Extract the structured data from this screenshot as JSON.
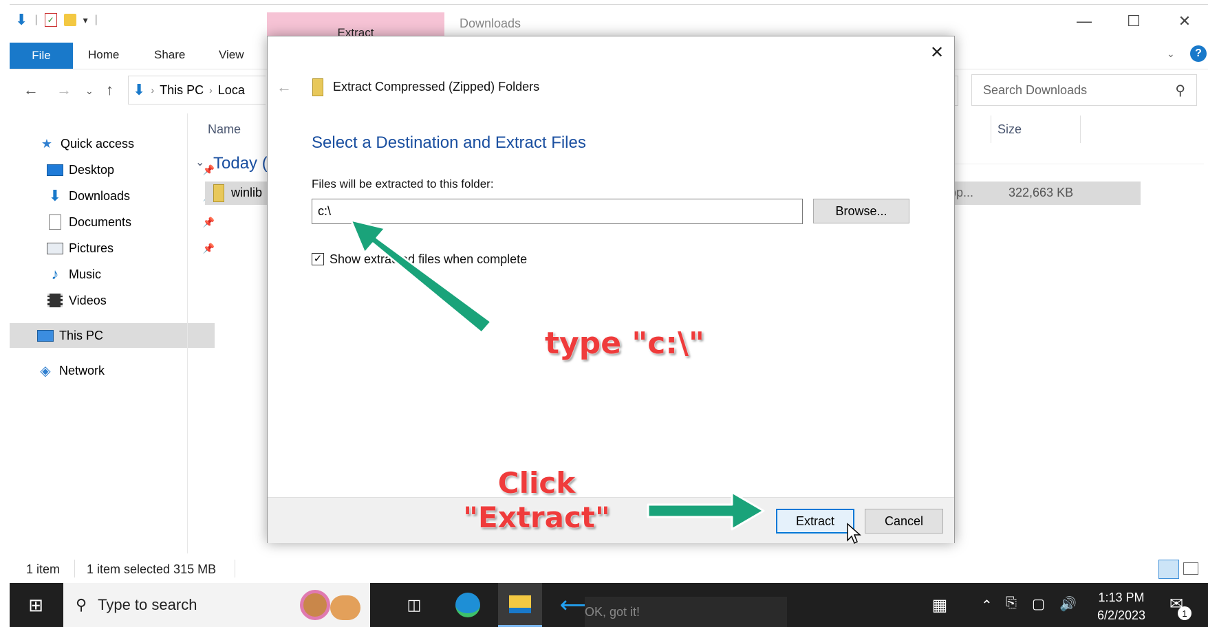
{
  "explorer": {
    "context_tab": "Extract",
    "window_title": "Downloads",
    "ribbon_tabs": [
      "File",
      "Home",
      "Share",
      "View"
    ],
    "address": {
      "crumbs": [
        "This PC",
        "Loca"
      ]
    },
    "search_placeholder": "Search Downloads",
    "nav": [
      {
        "label": "Quick access",
        "icon": "star-icon"
      },
      {
        "label": "Desktop",
        "icon": "desktop-icon",
        "pinned": true
      },
      {
        "label": "Downloads",
        "icon": "downloads-icon",
        "pinned": true
      },
      {
        "label": "Documents",
        "icon": "documents-icon",
        "pinned": true
      },
      {
        "label": "Pictures",
        "icon": "pictures-icon",
        "pinned": true
      },
      {
        "label": "Music",
        "icon": "music-icon"
      },
      {
        "label": "Videos",
        "icon": "videos-icon"
      },
      {
        "label": "This PC",
        "icon": "this-pc-icon",
        "selected": true
      },
      {
        "label": "Network",
        "icon": "network-icon"
      }
    ],
    "columns": {
      "name": "Name",
      "size": "Size"
    },
    "group_label": "Today (",
    "file": {
      "name": "winlib",
      "type": "pp...",
      "size": "322,663 KB"
    },
    "status": {
      "count": "1 item",
      "selected": "1 item selected  315 MB"
    }
  },
  "dialog": {
    "title": "Extract Compressed (Zipped) Folders",
    "heading": "Select a Destination and Extract Files",
    "dest_label": "Files will be extracted to this folder:",
    "dest_value": "c:\\",
    "browse_label": "Browse...",
    "show_files_label": "Show extracted files when complete",
    "show_files_checked": true,
    "extract_label": "Extract",
    "cancel_label": "Cancel"
  },
  "annotations": {
    "type_hint": "type \"c:\\\"",
    "click_line1": "Click",
    "click_line2": "\"Extract\"",
    "arrow_color": "#1aa37a",
    "text_color": "#ef3b3b"
  },
  "taskbar": {
    "search_placeholder": "Type to search",
    "toast_text": "OK, got it!",
    "time": "1:13 PM",
    "date": "6/2/2023",
    "notification_count": "1"
  },
  "colors": {
    "accent": "#1979ca",
    "dialog_heading": "#1a4fa0",
    "context_tab": "#f6c3d5"
  }
}
